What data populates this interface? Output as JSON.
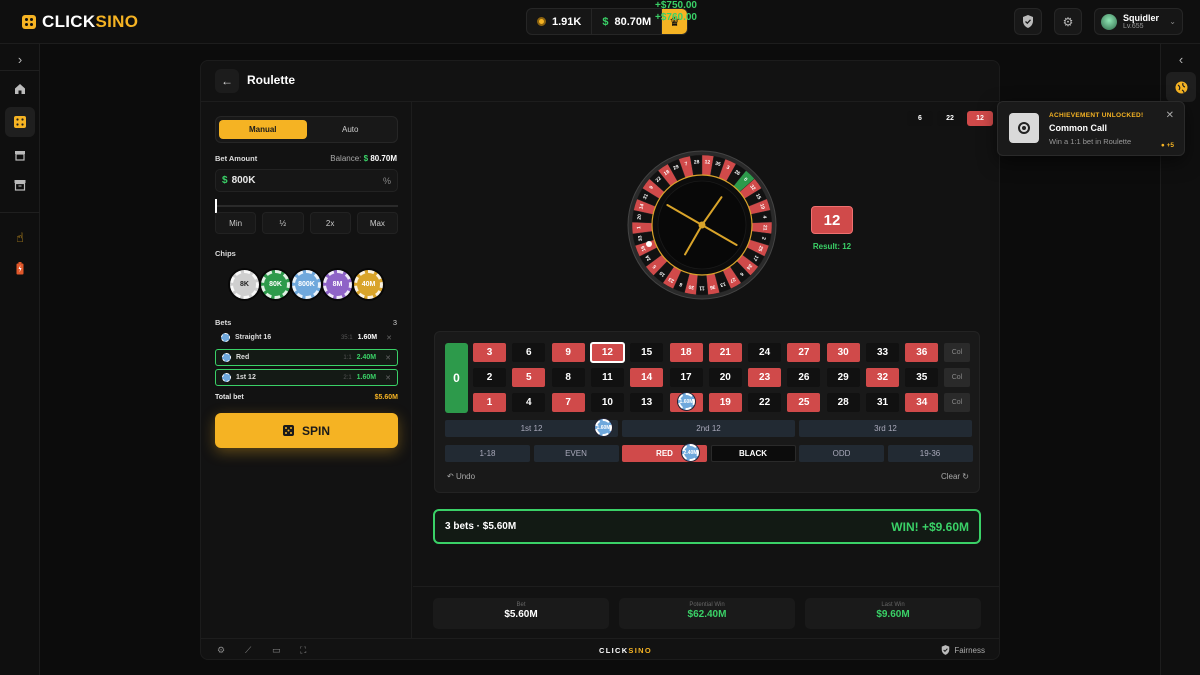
{
  "header": {
    "logo_part1": "CLICK",
    "logo_part2": "SINO",
    "coins": "1.91K",
    "balance": "80.70M",
    "gain_top": "+$750.00",
    "gain_bottom": "+$760.00",
    "user_name": "Squidler",
    "user_level": "Lv.655"
  },
  "game": {
    "title": "Roulette",
    "tabs": [
      "Manual",
      "Auto"
    ],
    "bet_amount_label": "Bet Amount",
    "balance_label": "Balance:",
    "balance_value": "80.70M",
    "bet_amount_value": "800K",
    "percent_symbol": "%",
    "slider_fraction": 0.0,
    "quick_buttons": [
      "Min",
      "½",
      "2x",
      "Max"
    ],
    "chips_label": "Chips",
    "chips": [
      {
        "label": "8K",
        "color": "#cfcfcf"
      },
      {
        "label": "80K",
        "color": "#2d9a4b"
      },
      {
        "label": "800K",
        "color": "#6fa8dc"
      },
      {
        "label": "8M",
        "color": "#8e63c7"
      },
      {
        "label": "40M",
        "color": "#d9a42a"
      }
    ],
    "bets_label": "Bets",
    "bets_count": "3",
    "bets": [
      {
        "name": "Straight 16",
        "mult": "35:1",
        "amount": "1.60M"
      },
      {
        "name": "Red",
        "mult": "1:1",
        "amount": "2.40M"
      },
      {
        "name": "1st 12",
        "mult": "2:1",
        "amount": "1.60M"
      }
    ],
    "total_bet_label": "Total bet",
    "total_bet_value": "$5.60M",
    "spin_label": "SPIN",
    "recent_results": [
      {
        "n": "6",
        "color": "black"
      },
      {
        "n": "22",
        "color": "black"
      },
      {
        "n": "12",
        "color": "red"
      }
    ],
    "result_number": "12",
    "result_text": "Result: 12",
    "board": {
      "zero": "0",
      "rows": [
        [
          3,
          6,
          9,
          12,
          15,
          18,
          21,
          24,
          27,
          30,
          33,
          36
        ],
        [
          2,
          5,
          8,
          11,
          14,
          17,
          20,
          23,
          26,
          29,
          32,
          35
        ],
        [
          1,
          4,
          7,
          10,
          13,
          16,
          19,
          22,
          25,
          28,
          31,
          34
        ]
      ],
      "red_numbers": [
        1,
        3,
        5,
        7,
        9,
        12,
        14,
        16,
        18,
        19,
        21,
        23,
        25,
        27,
        30,
        32,
        34,
        36
      ],
      "selected": 12,
      "col_label": "Col",
      "dozens": [
        "1st 12",
        "2nd 12",
        "3rd 12"
      ],
      "outside": [
        "1-18",
        "EVEN",
        "RED",
        "BLACK",
        "ODD",
        "19-36"
      ],
      "chip_labels": [
        "1.60M",
        "1.60M",
        "2.40M"
      ],
      "undo_label": "Undo",
      "clear_label": "Clear"
    },
    "summary_bets": "3 bets · $5.60M",
    "summary_win": "WIN! +$9.60M",
    "stats": [
      {
        "label": "Bet",
        "value": "$5.60M"
      },
      {
        "label": "Potential Win",
        "value": "$62.40M"
      },
      {
        "label": "Last Win",
        "value": "$9.60M"
      }
    ],
    "footer_logo1": "CLICK",
    "footer_logo2": "SINO",
    "fairness": "Fairness"
  },
  "wheel": {
    "sequence": [
      0,
      32,
      15,
      19,
      4,
      21,
      2,
      25,
      17,
      34,
      6,
      27,
      13,
      36,
      11,
      30,
      8,
      23,
      10,
      5,
      24,
      16,
      33,
      1,
      20,
      14,
      31,
      9,
      22,
      18,
      29,
      7,
      28,
      12,
      35,
      3,
      26
    ]
  },
  "toast": {
    "heading": "ACHIEVEMENT UNLOCKED!",
    "title": "Common Call",
    "desc": "Win a 1:1 bet in Roulette",
    "reward": "+5"
  },
  "colors": {
    "accent": "#f5b323",
    "green": "#3ad167",
    "red": "#d04a4a",
    "black": "#111111"
  }
}
